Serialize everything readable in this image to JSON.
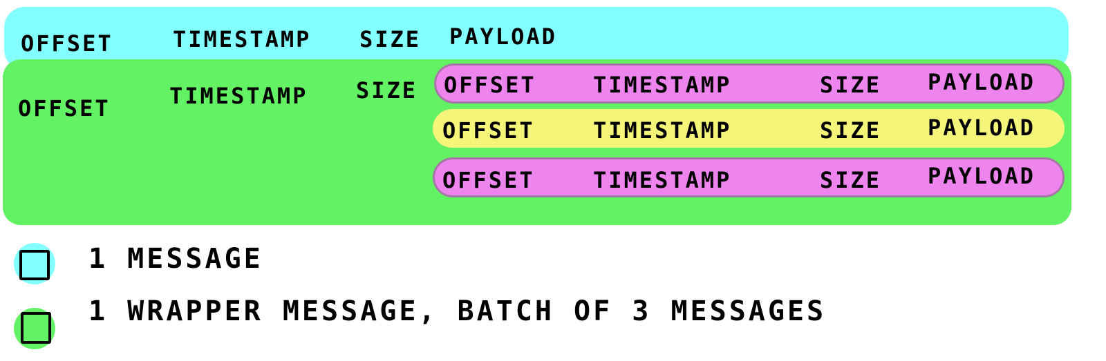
{
  "colors": {
    "single_message": "#84ffff",
    "wrapper_message": "#63f263",
    "inner_message_a": "#ee84ee",
    "inner_message_b": "#f5f57a"
  },
  "single_message_row": {
    "fields": [
      "OFFSET",
      "TIMESTAMP",
      "SIZE",
      "PAYLOAD"
    ]
  },
  "wrapper_row": {
    "fields": [
      "OFFSET",
      "TIMESTAMP",
      "SIZE"
    ]
  },
  "inner_messages": [
    {
      "fields": [
        "OFFSET",
        "TIMESTAMP",
        "SIZE",
        "PAYLOAD"
      ]
    },
    {
      "fields": [
        "OFFSET",
        "TIMESTAMP",
        "SIZE",
        "PAYLOAD"
      ]
    },
    {
      "fields": [
        "OFFSET",
        "TIMESTAMP",
        "SIZE",
        "PAYLOAD"
      ]
    }
  ],
  "legend": [
    {
      "text": "1 MESSAGE"
    },
    {
      "text": "1 WRAPPER MESSAGE, BATCH OF 3 MESSAGES"
    }
  ]
}
